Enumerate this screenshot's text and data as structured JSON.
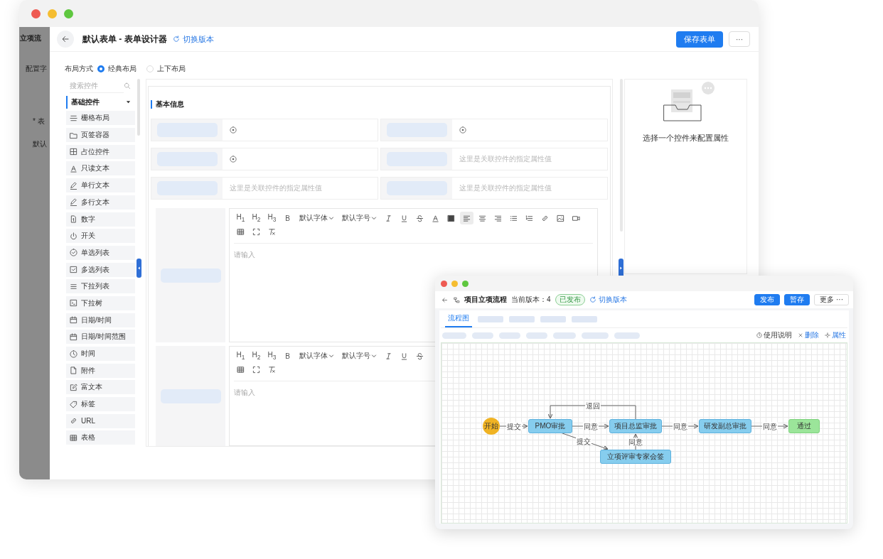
{
  "main_window": {
    "background_labels": [
      "立项流",
      "配置字",
      "* 表",
      "默认"
    ],
    "title": "默认表单 - 表单设计器",
    "switch_version": "切换版本",
    "save_button": "保存表单",
    "more_button": "···",
    "layout_label": "布局方式",
    "layout_options": [
      {
        "label": "经典布局",
        "selected": true
      },
      {
        "label": "上下布局",
        "selected": false
      }
    ],
    "search": {
      "placeholder": "搜索控件"
    },
    "palette_group": {
      "label": "基础控件",
      "expanded": true
    },
    "palette_items": [
      "栅格布局",
      "页签容器",
      "占位控件",
      "只读文本",
      "单行文本",
      "多行文本",
      "数字",
      "开关",
      "单选列表",
      "多选列表",
      "下拉列表",
      "下拉树",
      "日期/时间",
      "日期/时间范围",
      "时间",
      "附件",
      "富文本",
      "标签",
      "URL",
      "表格"
    ],
    "section_title": "基本信息",
    "field_rows": [
      [
        {
          "kind": "icon"
        },
        {
          "kind": "icon"
        }
      ],
      [
        {
          "kind": "icon"
        },
        {
          "kind": "text",
          "text": "这里是关联控件的指定属性值"
        }
      ],
      [
        {
          "kind": "text",
          "text": "这里是关联控件的指定属性值"
        },
        {
          "kind": "text",
          "text": "这里是关联控件的指定属性值"
        }
      ]
    ],
    "editors": [
      {
        "headings": [
          "H$_{1}$",
          "H$_{2}$",
          "H$_{3}$"
        ],
        "bold": "B",
        "dropdowns": [
          "默认字体",
          "默认字号"
        ],
        "alignments": [
          {
            "selected": true
          },
          {
            "selected": false
          },
          {
            "selected": false
          }
        ],
        "placeholder": "请输入"
      },
      {
        "headings": [
          "H$_{1}$",
          "H$_{2}$",
          "H$_{3}$"
        ],
        "bold": "B",
        "dropdowns": [
          "默认字体",
          "默认字号"
        ],
        "placeholder": "请输入"
      }
    ],
    "property_hint": "选择一个控件来配置属性"
  },
  "flow_window": {
    "title": "项目立项流程",
    "version": "当前版本：4",
    "status": "已发布",
    "switch_version": "切换版本",
    "buttons": [
      {
        "label": "发布",
        "primary": true
      },
      {
        "label": "暂存",
        "primary": true
      },
      {
        "label": "更多 ···",
        "primary": false
      }
    ],
    "tabs": [
      {
        "label": "流程图",
        "selected": true
      }
    ],
    "tools": [
      "使用说明",
      "删除",
      "属性"
    ],
    "nodes": [
      {
        "kind": "start",
        "text": "开始"
      },
      {
        "kind": "task",
        "text": "PMO审批"
      },
      {
        "kind": "task",
        "text": "项目总监审批"
      },
      {
        "kind": "task",
        "text": "研发副总审批"
      },
      {
        "kind": "end",
        "text": "通过"
      },
      {
        "kind": "task",
        "text": "立项评审专家会签"
      }
    ],
    "edges": [
      "提交",
      "同意",
      "同意",
      "同意",
      "退回",
      "提交",
      "同意"
    ]
  }
}
